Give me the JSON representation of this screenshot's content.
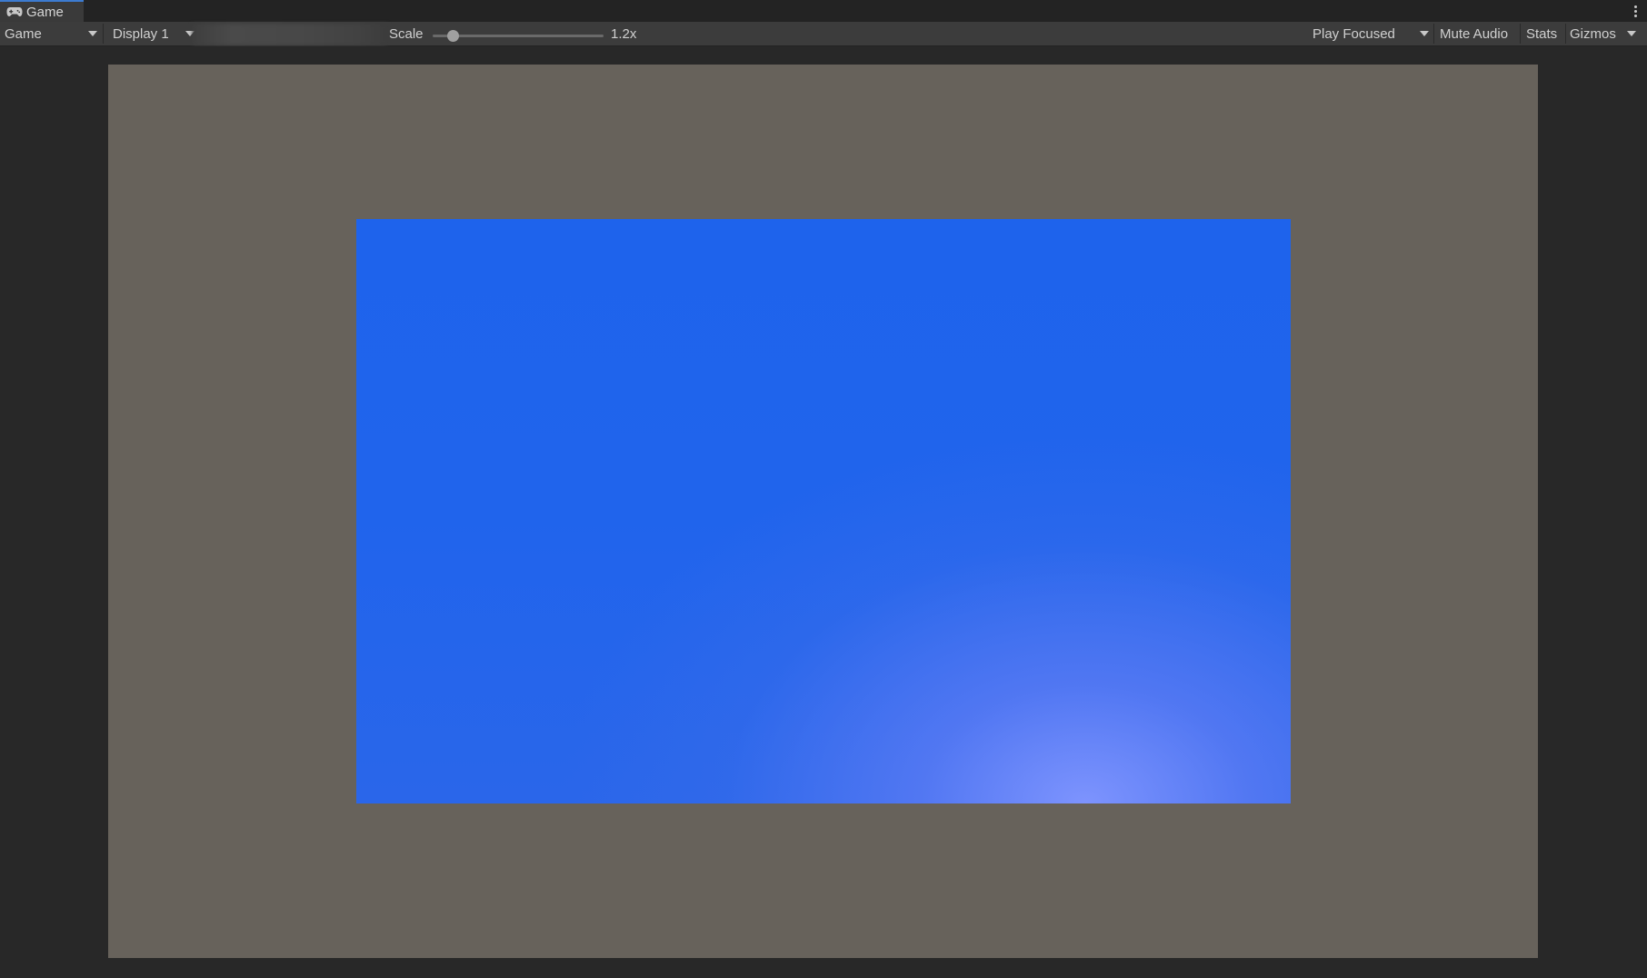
{
  "tab": {
    "label": "Game",
    "icon": "gamepad-icon"
  },
  "toolbar": {
    "view_dropdown": "Game",
    "display_dropdown": "Display 1",
    "scale_label": "Scale",
    "scale_value": "1.2x",
    "scale_slider_fraction": 0.12,
    "play_mode_dropdown": "Play Focused",
    "mute_audio": "Mute Audio",
    "stats": "Stats",
    "gizmos": "Gizmos"
  },
  "colors": {
    "accent": "#3c7bd0",
    "toolbar_bg": "#3c3c3c",
    "frame_bg": "#67625b",
    "sky_blue": "#1e63ec"
  }
}
